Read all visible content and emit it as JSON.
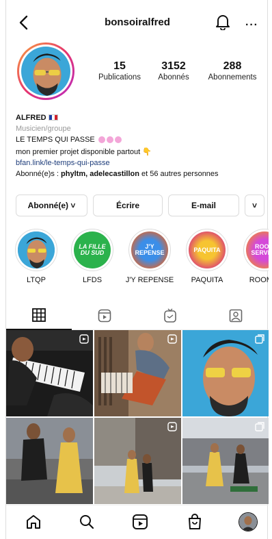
{
  "header": {
    "username": "bonsoiralfred",
    "more_label": "···"
  },
  "stats": [
    {
      "value": "15",
      "label": "Publications"
    },
    {
      "value": "3152",
      "label": "Abonnés"
    },
    {
      "value": "288",
      "label": "Abonnements"
    }
  ],
  "bio": {
    "name": "ALFRED",
    "category": "Musicien/groupe",
    "line1": "LE TEMPS QUI PASSE",
    "line2": "mon premier projet disponible partout 👇",
    "link": "bfan.link/le-temps-qui-passe",
    "followed_prefix": "Abonné(e)s : ",
    "followed_names": "phyltm, adelecastillon",
    "followed_suffix": " et 56 autres personnes"
  },
  "actions": {
    "following_label": "Abonné(e) ˅",
    "message_label": "Écrire",
    "email_label": "E-mail",
    "more_label": "˅"
  },
  "highlights": [
    {
      "label": "LTQP",
      "cover_text": "",
      "color": "#1a1a1a"
    },
    {
      "label": "LFDS",
      "cover_text": "LA FILLE DU SUD",
      "color": "#2bb24c"
    },
    {
      "label": "J'Y REPENSE",
      "cover_text": "J'Y REPENSE",
      "color": "#2a6fd6"
    },
    {
      "label": "PAQUITA",
      "cover_text": "PAQUITA",
      "color": "#f0a019"
    },
    {
      "label": "ROOM S",
      "cover_text": "ROOM SERVICE",
      "color": "#c43ad6"
    }
  ],
  "tabs": [
    {
      "name": "grid",
      "icon": "grid-icon",
      "active": true
    },
    {
      "name": "reels",
      "icon": "reels-icon",
      "active": false
    },
    {
      "name": "igtv",
      "icon": "igtv-icon",
      "active": false
    },
    {
      "name": "tagged",
      "icon": "tagged-icon",
      "active": false
    }
  ],
  "colors": {
    "story_ring": "#e6356e",
    "link": "#1d3c7a",
    "muted": "#999999",
    "border": "#dbdbdb"
  },
  "bottom_nav": [
    {
      "name": "home",
      "icon": "home-icon"
    },
    {
      "name": "search",
      "icon": "search-icon"
    },
    {
      "name": "reels",
      "icon": "reels-icon"
    },
    {
      "name": "shop",
      "icon": "shop-icon"
    },
    {
      "name": "profile",
      "icon": "profile-avatar"
    }
  ]
}
